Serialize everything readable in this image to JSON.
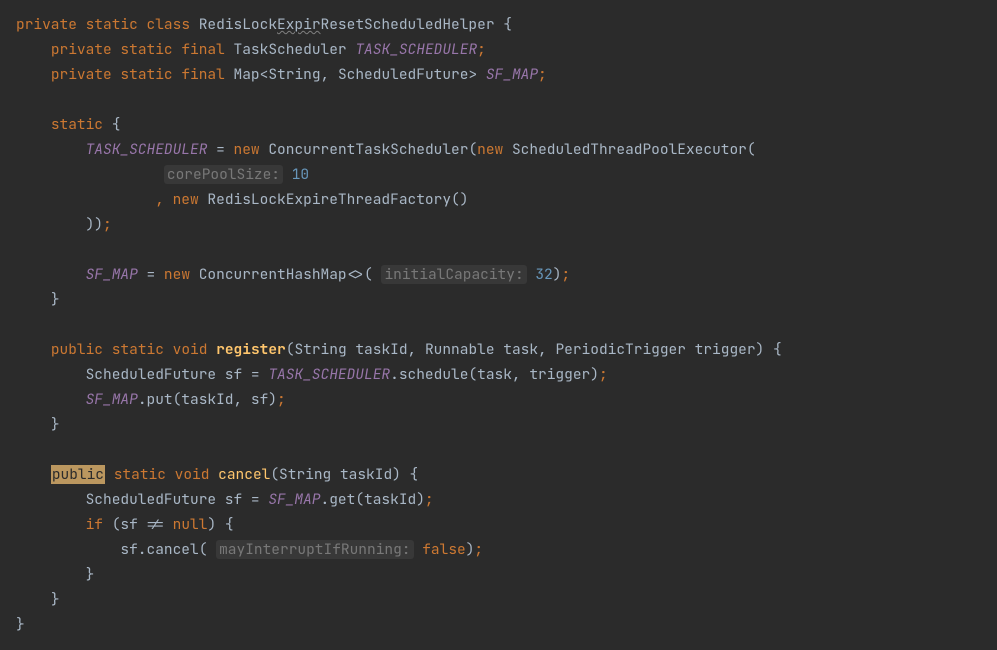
{
  "code": {
    "l1_private": "private",
    "l1_static": "static",
    "l1_class": "class",
    "l1_name": "RedisLock",
    "l1_name_wavy": "Expir",
    "l1_name2": "ResetScheduledHelper",
    "l1_ob": "{",
    "l2_private": "private",
    "l2_static": "static",
    "l2_final": "final",
    "l2_type": "TaskScheduler",
    "l2_field": "TASK_SCHEDULER",
    "l2_sc": ";",
    "l3_private": "private",
    "l3_static": "static",
    "l3_final": "final",
    "l3_type": "Map",
    "l3_gen": "<String, ScheduledFuture>",
    "l3_field": "SF_MAP",
    "l3_sc": ";",
    "l5_static": "static",
    "l5_ob": "{",
    "l6_field": "TASK_SCHEDULER",
    "l6_eq": " = ",
    "l6_new": "new",
    "l6_type": "ConcurrentTaskScheduler",
    "l6_op": "(",
    "l6_new2": "new",
    "l6_type2": "ScheduledThreadPoolExecutor",
    "l6_op2": "(",
    "l7_hint": "corePoolSize:",
    "l7_num": "10",
    "l8_comma": ",",
    "l8_new": "new",
    "l8_type": "RedisLockExpireThreadFactory",
    "l8_parens": "()",
    "l9_close": "))",
    "l9_sc": ";",
    "l11_field": "SF_MAP",
    "l11_eq": " = ",
    "l11_new": "new",
    "l11_type": "ConcurrentHashMap",
    "l11_gen": "<>",
    "l11_op": "(",
    "l11_hint": "initialCapacity:",
    "l11_num": "32",
    "l11_cp": ")",
    "l11_sc": ";",
    "l12_cb": "}",
    "l14_public": "public",
    "l14_static": "static",
    "l14_void": "void",
    "l14_method": "register",
    "l14_params": "(String taskId, Runnable task, PeriodicTrigger trigger)",
    "l14_ob": "{",
    "l15_type": "ScheduledFuture",
    "l15_var": " sf = ",
    "l15_field": "TASK_SCHEDULER",
    "l15_call": ".schedule(task, trigger)",
    "l15_sc": ";",
    "l16_field": "SF_MAP",
    "l16_call": ".put(taskId, sf)",
    "l16_sc": ";",
    "l17_cb": "}",
    "l19_public": "public",
    "l19_static": "static",
    "l19_void": "void",
    "l19_method": "cancel",
    "l19_params": "(String taskId)",
    "l19_ob": "{",
    "l20_type": "ScheduledFuture",
    "l20_var": " sf = ",
    "l20_field": "SF_MAP",
    "l20_call": ".get(taskId)",
    "l20_sc": ";",
    "l21_if": "if",
    "l21_cond": " (sf != ",
    "l21_null": "null",
    "l21_cp": ") ",
    "l21_ob": "{",
    "l22_call": "sf.cancel(",
    "l22_hint": "mayInterruptIfRunning:",
    "l22_false": "false",
    "l22_cp": ")",
    "l22_sc": ";",
    "l23_cb": "}",
    "l24_cb": "}",
    "l25_cb": "}"
  }
}
